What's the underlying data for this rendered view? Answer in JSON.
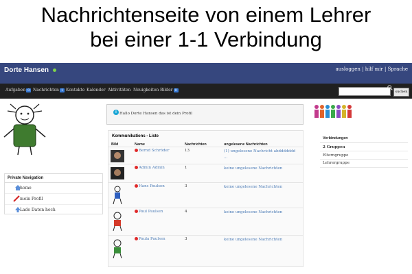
{
  "headline": {
    "line1": "Nachrichtenseite von einem Lehrer",
    "line2": "bei einer 1-1 Verbindung"
  },
  "topbar": {
    "user_name": "Dorte Hansen",
    "links": [
      "ausloggen",
      "hilf mir",
      "Sprache"
    ],
    "separator": "|"
  },
  "nav": {
    "items": [
      {
        "label": "Aufgaben",
        "badge": "0"
      },
      {
        "label": "Nachrichten",
        "badge": "1"
      },
      {
        "label": "Kontakte",
        "badge": ""
      },
      {
        "label": "Kalender",
        "badge": ""
      },
      {
        "label": "Aktivitäten",
        "badge": ""
      },
      {
        "label": "Neuigkeiten",
        "badge": ""
      },
      {
        "label": "Bilder",
        "badge": "0"
      }
    ],
    "search_placeholder": "",
    "search_button_label": "suchen"
  },
  "private_nav": {
    "title": "Private Navigation",
    "items": [
      "home",
      "mein Profil",
      "Lade Daten hoch"
    ]
  },
  "info": {
    "text": "Hallo Dorte Hansen das ist dein Profil"
  },
  "communications": {
    "title": "Kommunikations - Liste",
    "headers": [
      "Bild",
      "Name",
      "Nachrichten",
      "ungelesene Nachrichten"
    ],
    "rows": [
      {
        "name": "Bernd Schröder",
        "count": "13",
        "unread": "(1) ungelesene Nachricht abddddddd ..."
      },
      {
        "name": "Admin Admin",
        "count": "1",
        "unread": "keine ungelesene Nachrichten"
      },
      {
        "name": "Hans Paulsen",
        "count": "3",
        "unread": "keine ungelesene Nachrichten"
      },
      {
        "name": "Paul Paulsen",
        "count": "4",
        "unread": "keine ungelesene Nachrichten"
      },
      {
        "name": "Paula Paulsen",
        "count": "3",
        "unread": "keine ungelesene Nachrichten"
      }
    ]
  },
  "connections": {
    "title": "Verbindungen",
    "group_count": "2 Gruppen",
    "groups": [
      "Elterngruppe",
      "Lehrergruppe"
    ]
  },
  "colors": {
    "topbar": "#36477e",
    "navbar": "#202020",
    "link": "#4a7ab5",
    "unread_dot": "#e02a2a",
    "badge": "#3a7bd5"
  }
}
